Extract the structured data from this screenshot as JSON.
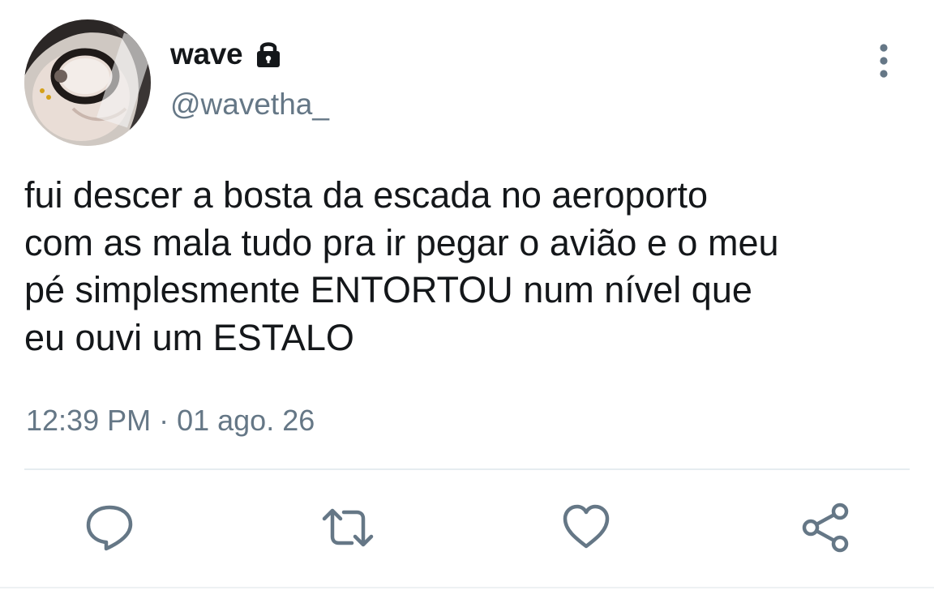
{
  "user": {
    "display_name": "wave",
    "handle": "@wavetha_",
    "protected_icon": "lock-icon",
    "avatar_icon": "avatar-photo"
  },
  "tweet": {
    "text": "fui descer a bosta da escada no aeroporto\ncom as mala tudo pra ir pegar o avião e o meu\npé simplesmente ENTORTOU num nível que\neu ouvi um ESTALO",
    "timestamp": "12:39 PM · 01 ago. 26"
  },
  "actions": [
    {
      "name": "reply",
      "icon": "reply-icon"
    },
    {
      "name": "retweet",
      "icon": "retweet-icon"
    },
    {
      "name": "like",
      "icon": "heart-icon"
    },
    {
      "name": "share",
      "icon": "share-icon"
    }
  ],
  "colors": {
    "text_primary": "#14171a",
    "text_secondary": "#657786",
    "icon": "#657786",
    "divider": "#e6ecf0"
  }
}
